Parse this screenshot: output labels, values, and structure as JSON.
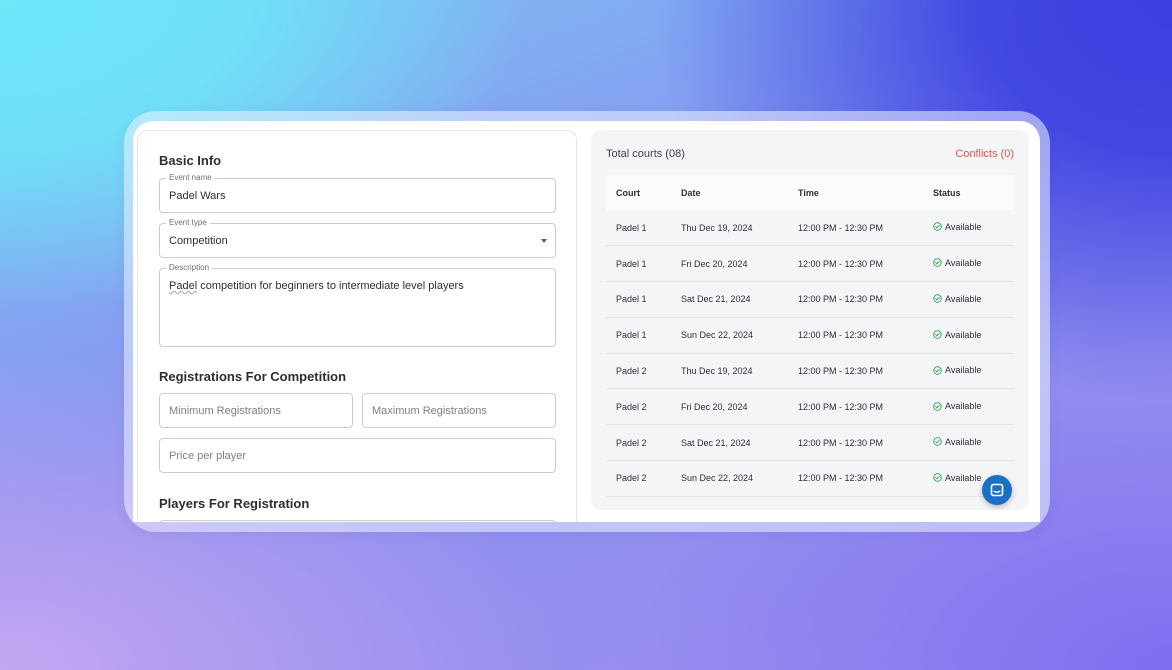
{
  "form": {
    "basic_info_title": "Basic Info",
    "event_name": {
      "label": "Event name",
      "value": "Padel Wars"
    },
    "event_type": {
      "label": "Event type",
      "value": "Competition"
    },
    "description": {
      "label": "Description",
      "value_first_word": "Padel",
      "value_rest": " competition for beginners to intermediate level players"
    },
    "registrations_title": "Registrations For Competition",
    "min_registrations_placeholder": "Minimum Registrations",
    "max_registrations_placeholder": "Maximum Registrations",
    "price_placeholder": "Price per player",
    "players_title": "Players For Registration"
  },
  "courts": {
    "total_label": "Total courts (08)",
    "conflicts_label": "Conflicts (0)",
    "columns": [
      "Court",
      "Date",
      "Time",
      "Status"
    ],
    "rows": [
      {
        "court": "Padel 1",
        "date": "Thu Dec 19, 2024",
        "time": "12:00 PM - 12:30 PM",
        "status": "Available"
      },
      {
        "court": "Padel 1",
        "date": "Fri Dec 20, 2024",
        "time": "12:00 PM - 12:30 PM",
        "status": "Available"
      },
      {
        "court": "Padel 1",
        "date": "Sat Dec 21, 2024",
        "time": "12:00 PM - 12:30 PM",
        "status": "Available"
      },
      {
        "court": "Padel 1",
        "date": "Sun Dec 22, 2024",
        "time": "12:00 PM - 12:30 PM",
        "status": "Available"
      },
      {
        "court": "Padel 2",
        "date": "Thu Dec 19, 2024",
        "time": "12:00 PM - 12:30 PM",
        "status": "Available"
      },
      {
        "court": "Padel 2",
        "date": "Fri Dec 20, 2024",
        "time": "12:00 PM - 12:30 PM",
        "status": "Available"
      },
      {
        "court": "Padel 2",
        "date": "Sat Dec 21, 2024",
        "time": "12:00 PM - 12:30 PM",
        "status": "Available"
      },
      {
        "court": "Padel 2",
        "date": "Sun Dec 22, 2024",
        "time": "12:00 PM - 12:30 PM",
        "status": "Available"
      }
    ]
  },
  "icons": {
    "status_icon": "check-circle-icon",
    "chat": "chat-icon",
    "dropdown": "chevron-down-icon"
  },
  "colors": {
    "conflict": "#e05858",
    "available": "#2fa34f",
    "chat_button": "#1c6fc7"
  }
}
